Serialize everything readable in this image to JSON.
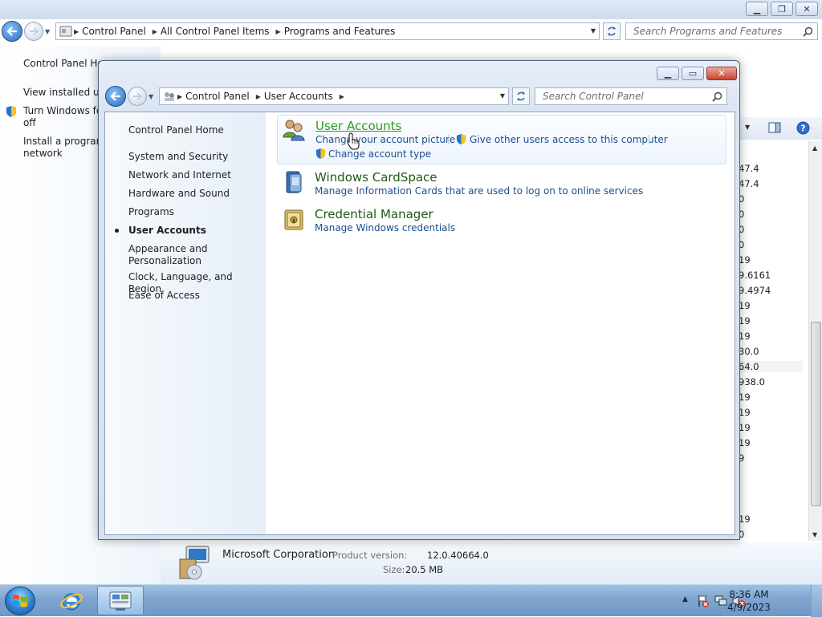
{
  "background_window": {
    "address": {
      "crumbs": [
        "Control Panel",
        "All Control Panel Items",
        "Programs and Features"
      ]
    },
    "search_placeholder": "Search Programs and Features",
    "left_links": [
      "Control Panel Hor",
      "View installed upc",
      "Turn Windows fea",
      "off",
      "Install a program f",
      "network"
    ],
    "list_values": [
      "47.4",
      "47.4",
      "0",
      "0",
      "0",
      "0",
      "19",
      "9.6161",
      "9.4974",
      "19",
      "19",
      "19",
      "30.0",
      "64.0",
      "938.0",
      "19",
      "19",
      "19",
      "19",
      "9",
      "19",
      "0"
    ],
    "details": {
      "publisher": "Microsoft Corporation",
      "product_version_label": "Product version:",
      "product_version": "12.0.40664.0",
      "size_label": "Size:",
      "size": "20.5 MB"
    }
  },
  "front_window": {
    "address": {
      "crumbs": [
        "Control Panel",
        "User Accounts"
      ]
    },
    "search_placeholder": "Search Control Panel",
    "nav": {
      "home": "Control Panel Home",
      "items": [
        "System and Security",
        "Network and Internet",
        "Hardware and Sound",
        "Programs",
        "User Accounts",
        "Appearance and Personalization",
        "Clock, Language, and Region",
        "Ease of Access"
      ],
      "current": "User Accounts"
    },
    "categories": [
      {
        "title": "User Accounts",
        "tasks": [
          "Change your account picture",
          "Give other users access to this computer",
          "Change account type"
        ]
      },
      {
        "title": "Windows CardSpace",
        "tasks": [
          "Manage Information Cards that are used to log on to online services"
        ]
      },
      {
        "title": "Credential Manager",
        "tasks": [
          "Manage Windows credentials"
        ]
      }
    ]
  },
  "taskbar": {
    "time": "8:36 AM",
    "date": "4/9/2023"
  },
  "colors": {
    "link_blue": "#1e4f8c",
    "category_green": "#1e5a14",
    "hover_green": "#2c9c1e",
    "taskbar": "#7ea5cf"
  }
}
